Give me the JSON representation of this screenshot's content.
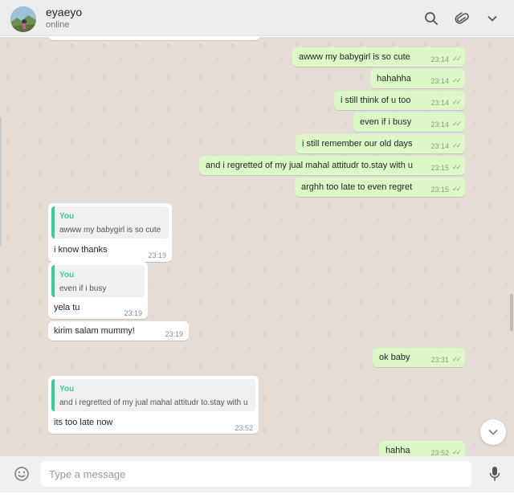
{
  "header": {
    "contact_name": "eyaeyo",
    "status": "online",
    "icons": [
      "search-icon",
      "attach-icon",
      "menu-chevron-icon"
    ]
  },
  "messages": [
    {
      "direction": "out",
      "text": "awww my babygirl is so cute",
      "time": "23:14",
      "status": "delivered"
    },
    {
      "direction": "out",
      "text": "hahahha",
      "time": "23:14",
      "status": "delivered"
    },
    {
      "direction": "out",
      "text": "i still think of u too",
      "time": "23:14",
      "status": "delivered"
    },
    {
      "direction": "out",
      "text": "even if i busy",
      "time": "23:14",
      "status": "delivered"
    },
    {
      "direction": "out",
      "text": "i still remember our old days",
      "time": "23:14",
      "status": "delivered"
    },
    {
      "direction": "out",
      "text": "and i regretted of my jual mahal attitudr to.stay with u",
      "time": "23:15",
      "status": "delivered"
    },
    {
      "direction": "out",
      "text": "arghh too late to even regret",
      "time": "23:15",
      "status": "delivered"
    },
    {
      "direction": "in",
      "quote_author": "You",
      "quote_text": "awww my babygirl is so cute",
      "text": "i know thanks",
      "time": "23:19"
    },
    {
      "direction": "in",
      "quote_author": "You",
      "quote_text": "even if i busy",
      "text": "yela tu",
      "time": "23:19"
    },
    {
      "direction": "in",
      "text": "kirim salam mummy!",
      "time": "23:19"
    },
    {
      "direction": "out",
      "text": "ok baby",
      "time": "23:31",
      "status": "delivered"
    },
    {
      "direction": "in",
      "quote_author": "You",
      "quote_text": "and i regretted of my jual mahal attitudr to.stay with u",
      "text": "its too late now",
      "time": "23:52"
    },
    {
      "direction": "out",
      "text": "hahha",
      "time": "23:52",
      "status": "delivered"
    }
  ],
  "composer": {
    "placeholder": "Type a message",
    "icons": [
      "emoji-icon",
      "microphone-icon"
    ]
  },
  "colors": {
    "outgoing_bubble": "#dcf8c6",
    "incoming_bubble": "#ffffff",
    "quote_accent": "#35cd96",
    "chat_background": "#e5ddd5",
    "header_background": "#ededed"
  }
}
